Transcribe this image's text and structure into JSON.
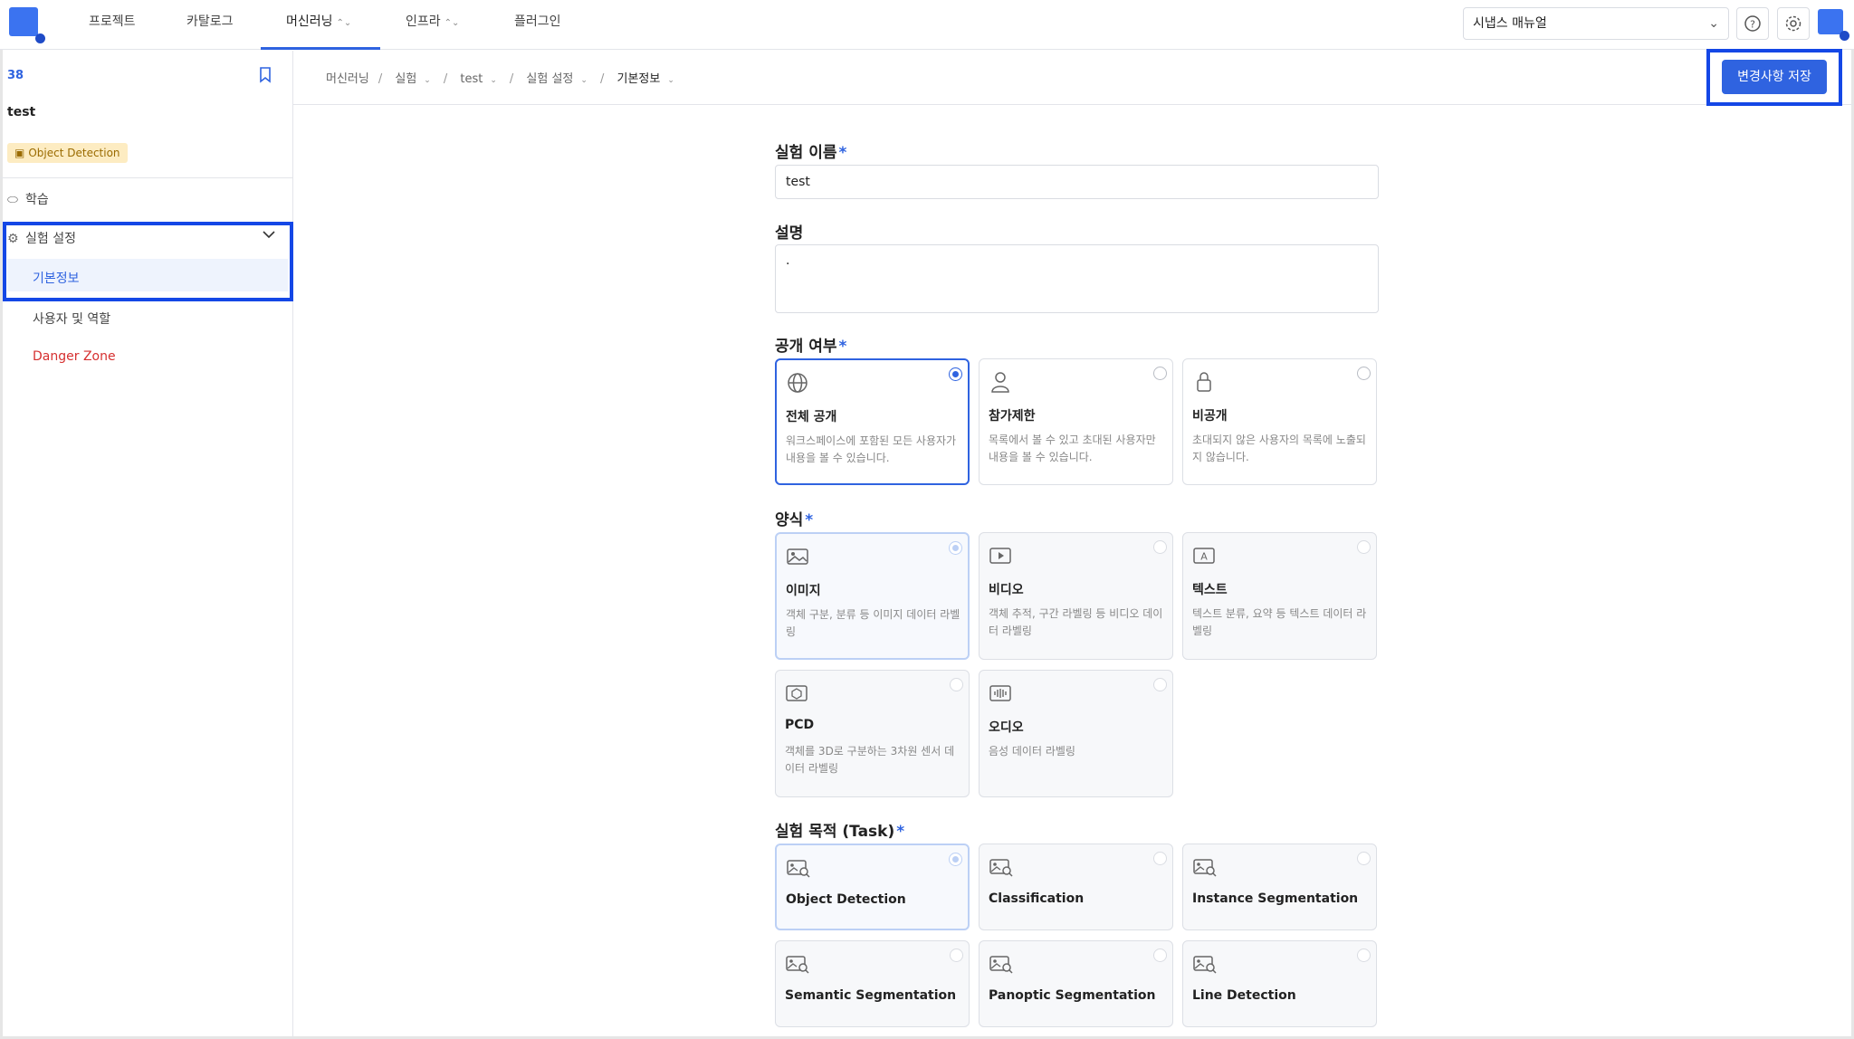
{
  "nav": {
    "items": [
      {
        "label": "프로젝트",
        "icon": ""
      },
      {
        "label": "카탈로그",
        "icon": ""
      },
      {
        "label": "머신러닝",
        "icon": "up-down-icon"
      },
      {
        "label": "인프라",
        "icon": "up-down-icon"
      },
      {
        "label": "플러그인",
        "icon": ""
      }
    ],
    "manual": "시냅스 매뉴얼",
    "help_icon": "help-icon",
    "settings_icon": "gear-icon"
  },
  "sidebar": {
    "id": "38",
    "title": "test",
    "tag": "Object Detection",
    "items": {
      "train": "학습",
      "settings": "실험 설정",
      "basic": "기본정보",
      "users": "사용자 및 역할",
      "danger": "Danger Zone"
    }
  },
  "breadcrumb": {
    "items": [
      "머신러닝",
      "실험",
      "test",
      "실험 설정",
      "기본정보"
    ]
  },
  "save_label": "변경사항 저장",
  "form": {
    "name_label": "실험 이름",
    "name_value": "test",
    "desc_label": "설명",
    "desc_value": ".",
    "visibility_label": "공개 여부",
    "visibility": [
      {
        "title": "전체 공개",
        "desc": "워크스페이스에 포함된 모든 사용자가 내용을 볼 수 있습니다.",
        "icon": "globe-icon",
        "selected": true
      },
      {
        "title": "참가제한",
        "desc": "목록에서 볼 수 있고 초대된 사용자만 내용을 볼 수 있습니다.",
        "icon": "user-icon",
        "selected": false
      },
      {
        "title": "비공개",
        "desc": "초대되지 않은 사용자의 목록에 노출되지 않습니다.",
        "icon": "lock-icon",
        "selected": false
      }
    ],
    "modality_label": "양식",
    "modality": [
      {
        "title": "이미지",
        "desc": "객체 구분, 분류 등 이미지 데이터 라벨링",
        "icon": "image-icon",
        "selected": true
      },
      {
        "title": "비디오",
        "desc": "객체 추적, 구간 라벨링 등 비디오 데이터 라벨링",
        "icon": "video-icon",
        "selected": false
      },
      {
        "title": "텍스트",
        "desc": "텍스트 분류, 요약 등 텍스트 데이터 라벨링",
        "icon": "text-icon",
        "selected": false
      },
      {
        "title": "PCD",
        "desc": "객체를 3D로 구분하는 3차원 센서 데이터 라벨링",
        "icon": "cube-icon",
        "selected": false
      },
      {
        "title": "오디오",
        "desc": "음성 데이터 라벨링",
        "icon": "audio-icon",
        "selected": false
      }
    ],
    "task_label": "실험 목적 (Task)",
    "tasks": [
      {
        "title": "Object Detection",
        "selected": true
      },
      {
        "title": "Classification",
        "selected": false
      },
      {
        "title": "Instance Segmentation",
        "selected": false
      },
      {
        "title": "Semantic Segmentation",
        "selected": false
      },
      {
        "title": "Panoptic Segmentation",
        "selected": false
      },
      {
        "title": "Line Detection",
        "selected": false
      }
    ]
  }
}
